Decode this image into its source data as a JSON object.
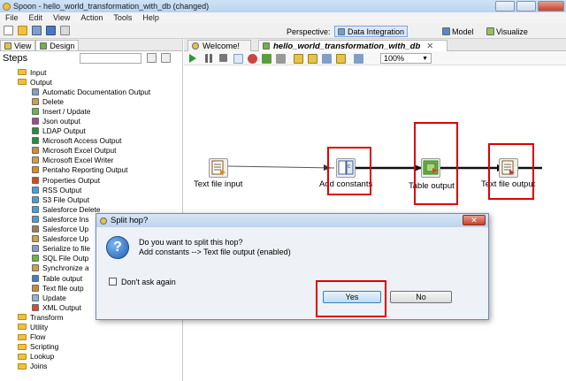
{
  "window": {
    "title": "Spoon - hello_world_transformation_with_db (changed)"
  },
  "menu": [
    "File",
    "Edit",
    "View",
    "Action",
    "Tools",
    "Help"
  ],
  "perspective": {
    "label": "Perspective:",
    "items": [
      "Data Integration",
      "Model",
      "Visualize"
    ]
  },
  "left_panel": {
    "tabs": [
      "View",
      "Design"
    ],
    "steps_label": "Steps",
    "tree": [
      {
        "label": "Input",
        "type": "folder",
        "indent": 0
      },
      {
        "label": "Output",
        "type": "folder",
        "indent": 0
      },
      {
        "label": "Automatic Documentation Output",
        "type": "step",
        "indent": 1
      },
      {
        "label": "Delete",
        "type": "step",
        "indent": 1
      },
      {
        "label": "Insert / Update",
        "type": "step",
        "indent": 1
      },
      {
        "label": "Json output",
        "type": "step",
        "indent": 1
      },
      {
        "label": "LDAP Output",
        "type": "step",
        "indent": 1
      },
      {
        "label": "Microsoft Access Output",
        "type": "step",
        "indent": 1
      },
      {
        "label": "Microsoft Excel Output",
        "type": "step",
        "indent": 1
      },
      {
        "label": "Microsoft Excel Writer",
        "type": "step",
        "indent": 1
      },
      {
        "label": "Pentaho Reporting Output",
        "type": "step",
        "indent": 1
      },
      {
        "label": "Properties Output",
        "type": "step",
        "indent": 1
      },
      {
        "label": "RSS Output",
        "type": "step",
        "indent": 1
      },
      {
        "label": "S3 File Output",
        "type": "step",
        "indent": 1
      },
      {
        "label": "Salesforce Delete",
        "type": "step",
        "indent": 1
      },
      {
        "label": "Salesforce Ins",
        "type": "step",
        "indent": 1
      },
      {
        "label": "Salesforce Up",
        "type": "step",
        "indent": 1
      },
      {
        "label": "Salesforce Up",
        "type": "step",
        "indent": 1
      },
      {
        "label": "Serialize to file",
        "type": "step",
        "indent": 1
      },
      {
        "label": "SQL File Outp",
        "type": "step",
        "indent": 1
      },
      {
        "label": "Synchronize a",
        "type": "step",
        "indent": 1
      },
      {
        "label": "Table output",
        "type": "step",
        "indent": 1
      },
      {
        "label": "Text file outp",
        "type": "step",
        "indent": 1
      },
      {
        "label": "Update",
        "type": "step",
        "indent": 1
      },
      {
        "label": "XML Output",
        "type": "step",
        "indent": 1
      },
      {
        "label": "Transform",
        "type": "folder",
        "indent": 0
      },
      {
        "label": "Utility",
        "type": "folder",
        "indent": 0
      },
      {
        "label": "Flow",
        "type": "folder",
        "indent": 0
      },
      {
        "label": "Scripting",
        "type": "folder",
        "indent": 0
      },
      {
        "label": "Lookup",
        "type": "folder",
        "indent": 0
      },
      {
        "label": "Joins",
        "type": "folder",
        "indent": 0
      }
    ]
  },
  "tabs": [
    {
      "label": "Welcome!"
    },
    {
      "label": "hello_world_transformation_with_db"
    }
  ],
  "zoom": "100%",
  "canvas": {
    "nodes": [
      {
        "id": "text-file-input",
        "label": "Text file input"
      },
      {
        "id": "add-constants",
        "label": "Add constants"
      },
      {
        "id": "table-output",
        "label": "Table output"
      },
      {
        "id": "text-file-output",
        "label": "Text file output"
      }
    ]
  },
  "dialog": {
    "title": "Split hop?",
    "question": "Do you want to split this hop?",
    "detail": "Add constants --> Text file output (enabled)",
    "checkbox_label": "Don't ask again",
    "yes_label": "Yes",
    "no_label": "No"
  }
}
